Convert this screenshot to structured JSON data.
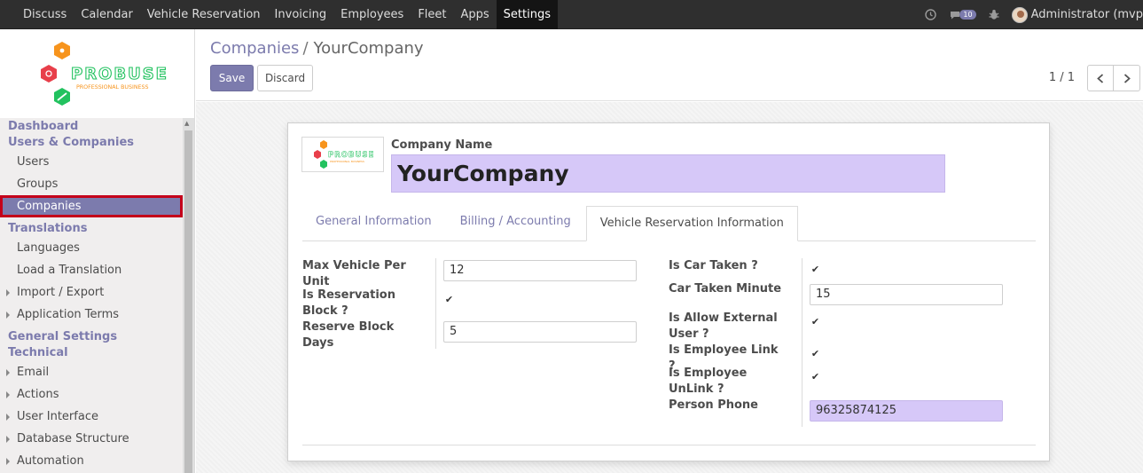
{
  "topbar": {
    "menu": [
      "Discuss",
      "Calendar",
      "Vehicle Reservation",
      "Invoicing",
      "Employees",
      "Fleet",
      "Apps",
      "Settings"
    ],
    "active_menu": "Settings",
    "chat_count": "10",
    "user": "Administrator (mvp"
  },
  "sidebar": {
    "logo": {
      "title": "PROBUSE",
      "subtitle": "PROFESSIONAL BUSINESS"
    },
    "section1": "Dashboard",
    "section2": "Users & Companies",
    "users": "Users",
    "groups": "Groups",
    "companies": "Companies",
    "section3": "Translations",
    "languages": "Languages",
    "load_translation": "Load a Translation",
    "import_export": "Import / Export",
    "app_terms": "Application Terms",
    "section4": "General Settings",
    "section5": "Technical",
    "email": "Email",
    "actions": "Actions",
    "user_interface": "User Interface",
    "db_structure": "Database Structure",
    "automation": "Automation"
  },
  "control": {
    "breadcrumb_parent": "Companies",
    "breadcrumb_sep": "/",
    "breadcrumb_current": "YourCompany",
    "save": "Save",
    "discard": "Discard",
    "pager": "1 / 1"
  },
  "form": {
    "company_name_label": "Company Name",
    "company_name": "YourCompany",
    "tabs": [
      "General Information",
      "Billing / Accounting",
      "Vehicle Reservation Information"
    ],
    "active_tab": "Vehicle Reservation Information",
    "left": {
      "max_vehicle_label": "Max Vehicle Per Unit",
      "max_vehicle_value": "12",
      "reservation_block_label": "Is Reservation Block ?",
      "reservation_block_checked": true,
      "reserve_days_label": "Reserve Block Days",
      "reserve_days_value": "5"
    },
    "right": {
      "car_taken_label": "Is Car Taken ?",
      "car_taken_checked": true,
      "car_taken_minute_label": "Car Taken Minute",
      "car_taken_minute_value": "15",
      "allow_external_label": "Is Allow External User ?",
      "allow_external_checked": true,
      "employee_link_label": "Is Employee Link ?",
      "employee_link_checked": true,
      "employee_unlink_label": "Is Employee UnLink ?",
      "employee_unlink_checked": true,
      "person_phone_label": "Person Phone",
      "person_phone_value": "96325874125"
    }
  },
  "colors": {
    "accent": "#7c7bad",
    "highlight": "#d6c8f8",
    "topbar": "#2f2f2f",
    "active_border": "#c4001a"
  }
}
